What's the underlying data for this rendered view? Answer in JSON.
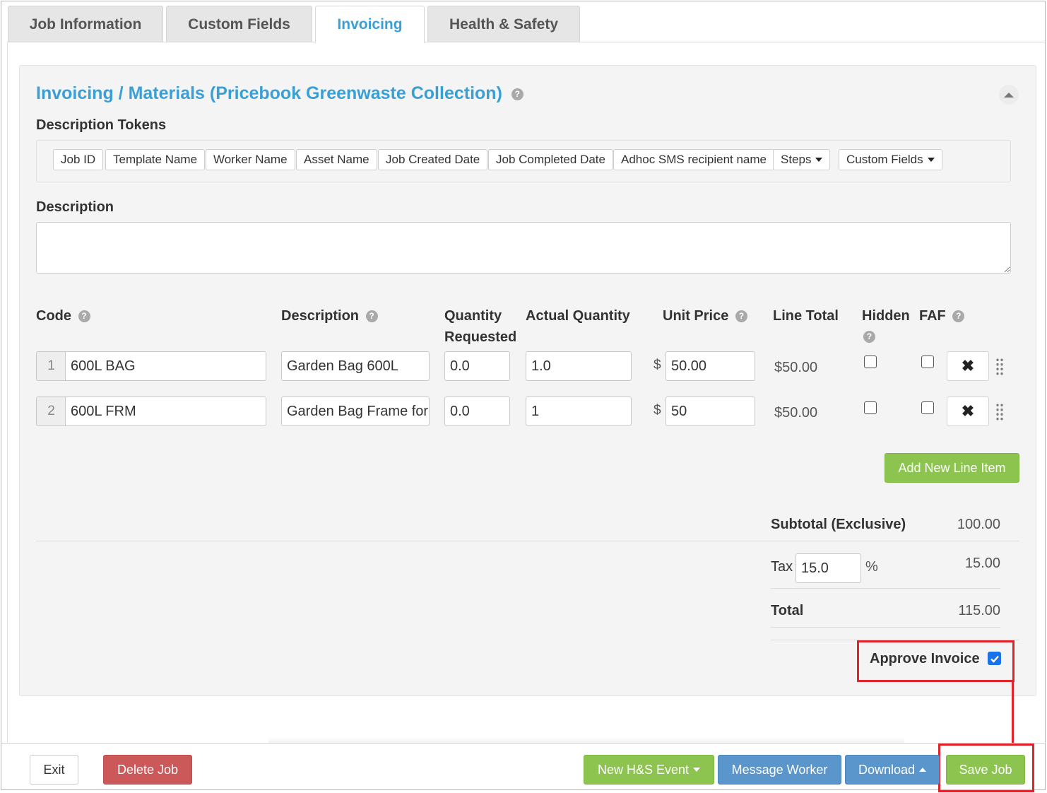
{
  "tabs": [
    {
      "label": "Job Information",
      "active": false
    },
    {
      "label": "Custom Fields",
      "active": false
    },
    {
      "label": "Invoicing",
      "active": true
    },
    {
      "label": "Health & Safety",
      "active": false
    }
  ],
  "panel": {
    "title": "Invoicing / Materials (Pricebook Greenwaste Collection)",
    "help_icon": "question-circle-icon",
    "collapse_icon": "chevron-up-icon"
  },
  "description_tokens": {
    "label": "Description Tokens",
    "tokens": [
      "Job ID",
      "Template Name",
      "Worker Name",
      "Asset Name",
      "Job Created Date",
      "Job Completed Date",
      "Adhoc SMS recipient name"
    ],
    "dropdowns": [
      "Steps",
      "Custom Fields"
    ]
  },
  "description": {
    "label": "Description",
    "value": ""
  },
  "line_items": {
    "headers": {
      "code": "Code",
      "description": "Description",
      "quantity_requested": "Quantity Requested",
      "actual_quantity": "Actual Quantity",
      "unit_price": "Unit Price",
      "line_total": "Line Total",
      "hidden": "Hidden",
      "faf": "FAF"
    },
    "currency_symbol": "$",
    "rows": [
      {
        "num": "1",
        "code": "600L BAG",
        "description": "Garden Bag 600L",
        "qty_requested": "0.0",
        "actual_qty": "1.0",
        "unit_price": "50.00",
        "line_total": "$50.00",
        "hidden": false,
        "faf": false
      },
      {
        "num": "2",
        "code": "600L FRM",
        "description": "Garden Bag Frame for",
        "qty_requested": "0.0",
        "actual_qty": "1",
        "unit_price": "50",
        "line_total": "$50.00",
        "hidden": false,
        "faf": false
      }
    ],
    "add_button": "Add New Line Item"
  },
  "totals": {
    "subtotal_label": "Subtotal (Exclusive)",
    "subtotal_value": "100.00",
    "tax_label": "Tax",
    "tax_rate": "15.0",
    "tax_unit": "%",
    "tax_value": "15.00",
    "total_label": "Total",
    "total_value": "115.00",
    "approve_label": "Approve Invoice",
    "approve_checked": true
  },
  "footer": {
    "exit": "Exit",
    "delete": "Delete Job",
    "new_hs_event": "New H&S Event",
    "message_worker": "Message Worker",
    "download": "Download",
    "save": "Save Job"
  },
  "colors": {
    "accent_blue": "#3a9fd5",
    "green": "#8cc44f",
    "blue": "#5a95cc",
    "red": "#cc5959",
    "highlight": "#e0242b"
  }
}
